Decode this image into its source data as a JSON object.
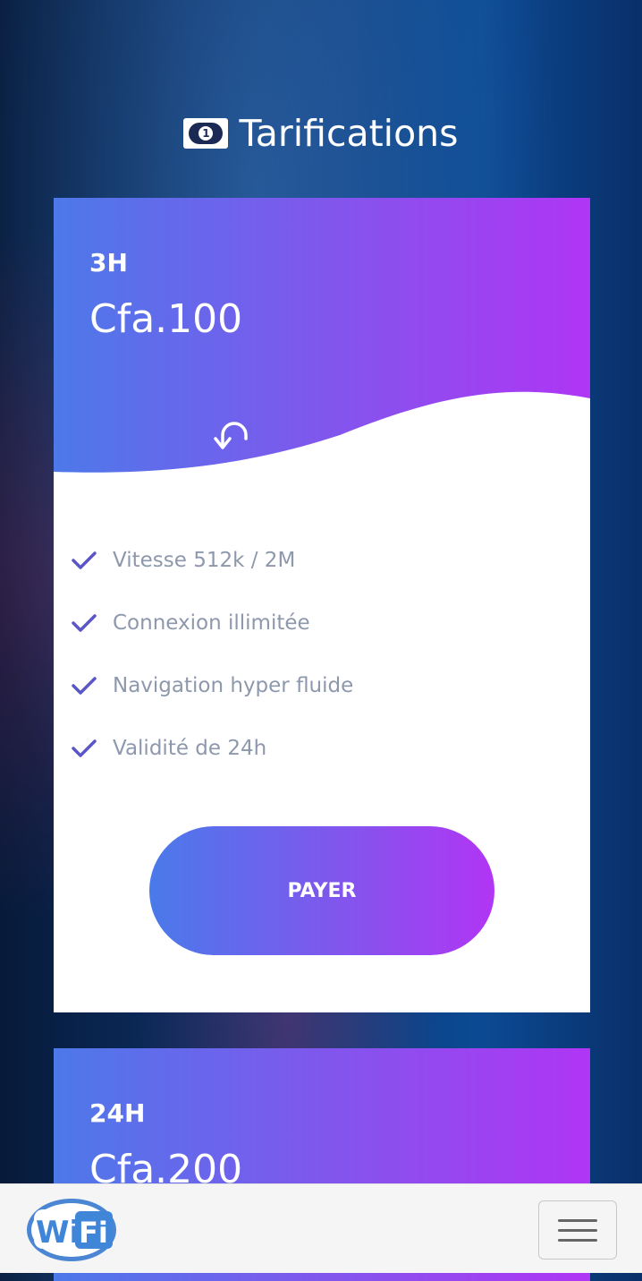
{
  "header": {
    "title": "Tarifications",
    "icon": "money-bill-icon"
  },
  "plans": [
    {
      "duration": "3H",
      "price": "Cfa.100",
      "features": [
        "Vitesse 512k / 2M",
        "Connexion illimitée",
        "Navigation hyper fluide",
        "Validité de 24h"
      ],
      "button_label": "PAYER"
    },
    {
      "duration": "24H",
      "price": "Cfa.200"
    }
  ],
  "bottom_bar": {
    "logo_text_wi": "Wi",
    "logo_text_fi": "Fi",
    "menu_icon": "hamburger-menu-icon"
  },
  "colors": {
    "gradient_start": "#4d79e9",
    "gradient_end": "#b035f4",
    "check": "#5a56c8",
    "feature_text": "#8e98ac"
  }
}
